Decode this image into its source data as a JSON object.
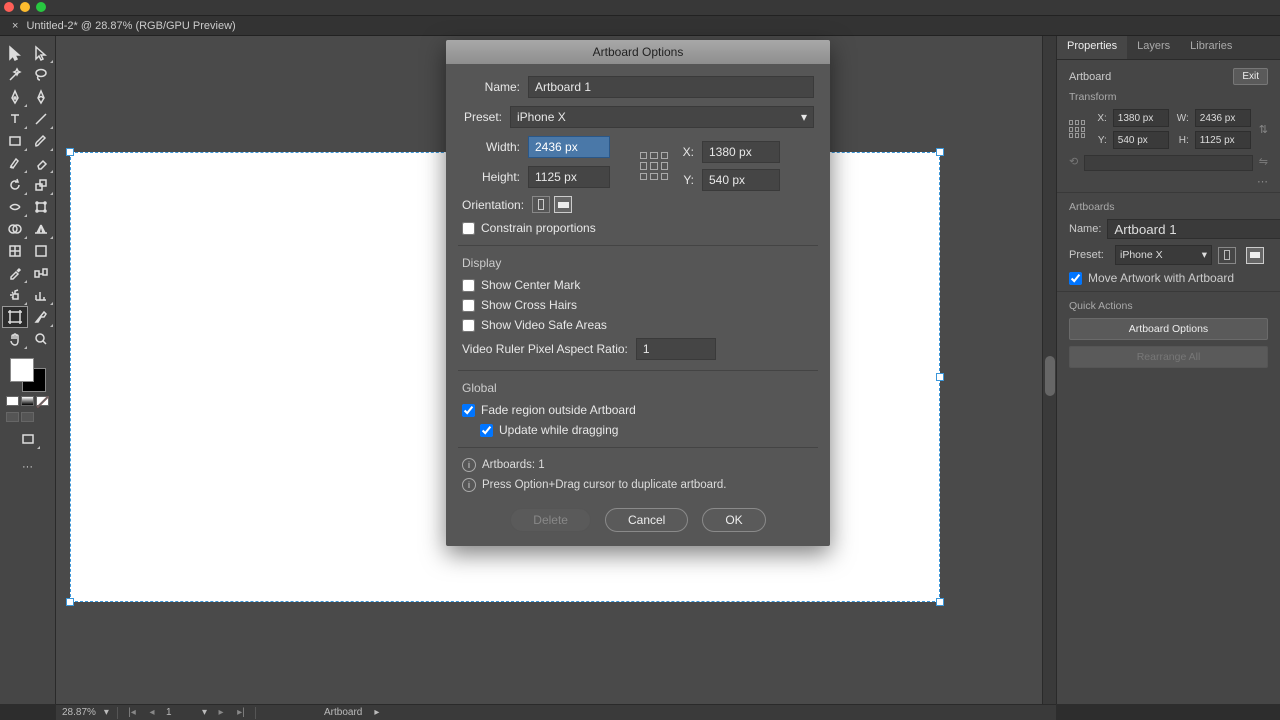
{
  "tab": {
    "title": "Untitled-2* @ 28.87% (RGB/GPU Preview)"
  },
  "dialog": {
    "title": "Artboard Options",
    "name_label": "Name:",
    "name_value": "Artboard 1",
    "preset_label": "Preset:",
    "preset_value": "iPhone X",
    "width_label": "Width:",
    "width_value": "2436 px",
    "height_label": "Height:",
    "height_value": "1125 px",
    "x_label": "X:",
    "x_value": "1380 px",
    "y_label": "Y:",
    "y_value": "540 px",
    "orientation_label": "Orientation:",
    "constrain": "Constrain proportions",
    "display": "Display",
    "show_center": "Show Center Mark",
    "show_cross": "Show Cross Hairs",
    "show_safe": "Show Video Safe Areas",
    "ruler_label": "Video Ruler Pixel Aspect Ratio:",
    "ruler_value": "1",
    "global": "Global",
    "fade": "Fade region outside Artboard",
    "update": "Update while dragging",
    "artboards_count": "Artboards: 1",
    "hint": "Press Option+Drag cursor to duplicate artboard.",
    "delete": "Delete",
    "cancel": "Cancel",
    "ok": "OK"
  },
  "panel": {
    "tabs": {
      "properties": "Properties",
      "layers": "Layers",
      "libraries": "Libraries"
    },
    "object_type": "Artboard",
    "exit": "Exit",
    "transform": "Transform",
    "x": "X:",
    "xv": "1380 px",
    "y": "Y:",
    "yv": "540 px",
    "w": "W:",
    "wv": "2436 px",
    "h": "H:",
    "hv": "1125 px",
    "artboards": "Artboards",
    "name_l": "Name:",
    "name_v": "Artboard 1",
    "preset_l": "Preset:",
    "preset_v": "iPhone X",
    "move_art": "Move Artwork with Artboard",
    "quick": "Quick Actions",
    "ab_opts": "Artboard Options",
    "rearr": "Rearrange All"
  },
  "status": {
    "zoom": "28.87%",
    "page": "1",
    "tool": "Artboard"
  },
  "colors": {
    "accent": "#3a96d9"
  }
}
